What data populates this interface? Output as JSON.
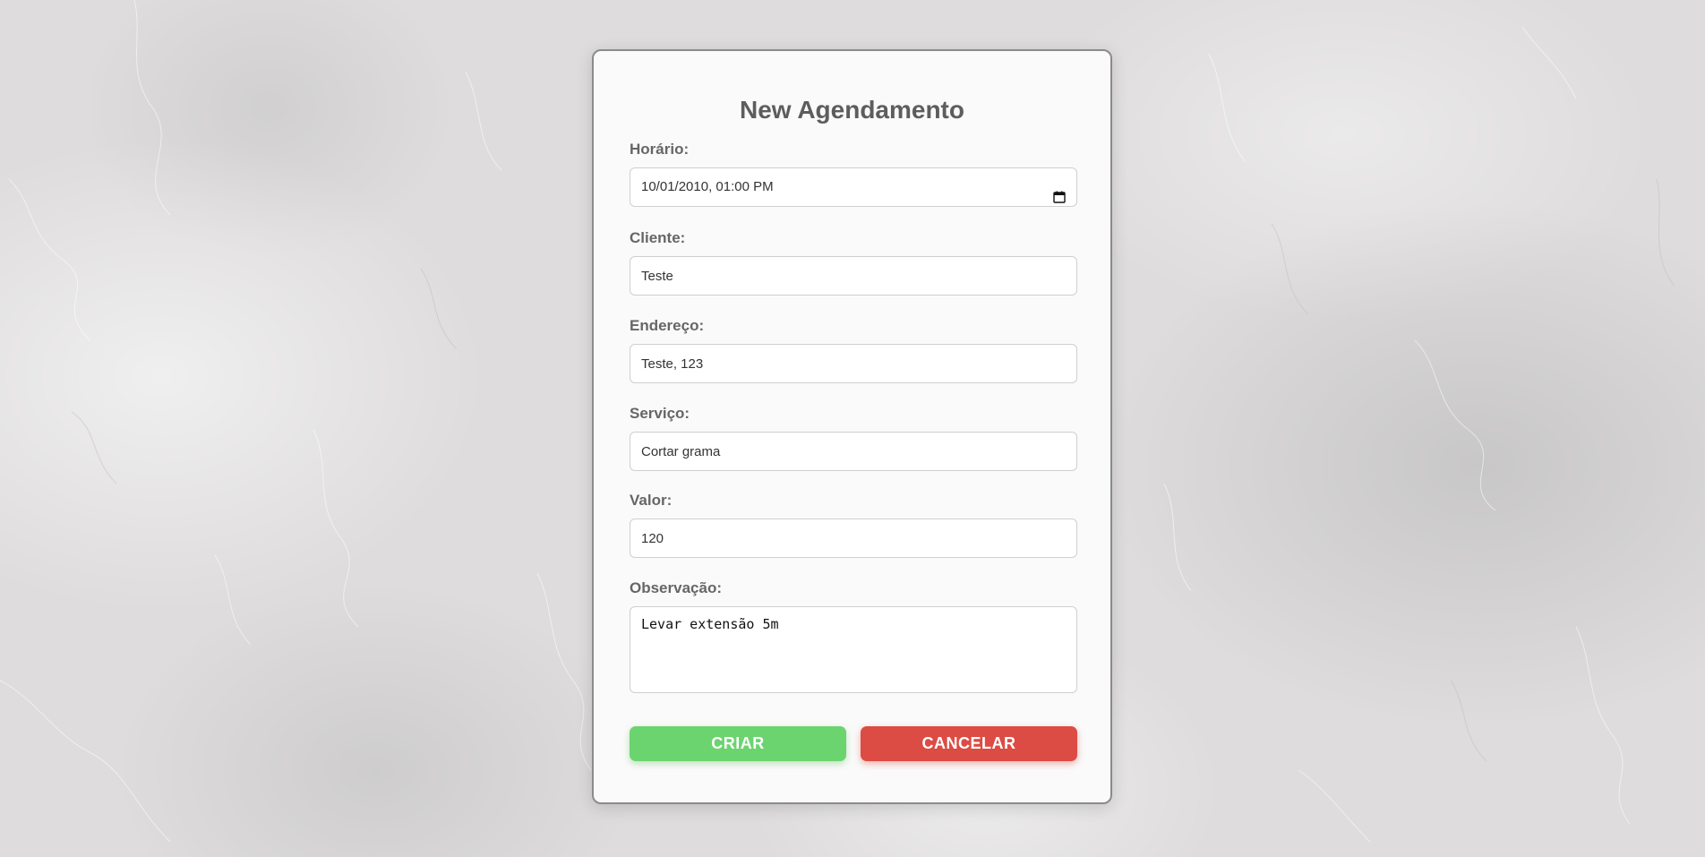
{
  "form": {
    "title": "New Agendamento",
    "fields": {
      "horario": {
        "label": "Horário:",
        "value": "10/01/2010, 01:00 PM"
      },
      "cliente": {
        "label": "Cliente:",
        "value": "Teste"
      },
      "endereco": {
        "label": "Endereço:",
        "value": "Teste, 123"
      },
      "servico": {
        "label": "Serviço:",
        "value": "Cortar grama"
      },
      "valor": {
        "label": "Valor:",
        "value": "120"
      },
      "observacao": {
        "label": "Observação:",
        "value": "Levar extensão 5m"
      }
    },
    "buttons": {
      "create_label": "CRIAR",
      "cancel_label": "CANCELAR"
    }
  },
  "colors": {
    "create_button": "#6bd46f",
    "cancel_button": "#dc4c44",
    "title_text": "#5d5d5d",
    "label_text": "#666666"
  },
  "icons": {
    "horario_picker": "calendar-icon"
  }
}
